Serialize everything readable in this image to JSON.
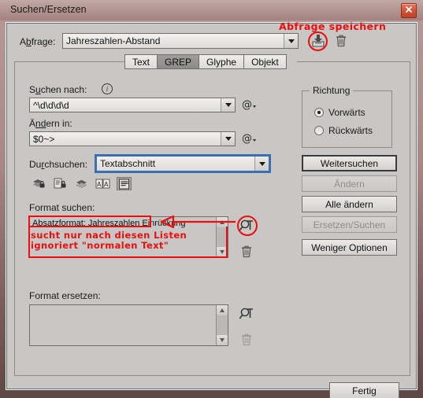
{
  "window": {
    "title": "Suchen/Ersetzen",
    "close_icon": "close-icon",
    "close_glyph": "✕"
  },
  "query_row": {
    "label": "Abfrage:",
    "label_prefix": "A",
    "label_accel": "b",
    "label_suffix": "frage:",
    "value": "Jahreszahlen-Abstand",
    "save_icon": "save-query-icon",
    "delete_icon": "delete-query-icon"
  },
  "tabs": [
    {
      "label": "Text",
      "active": false
    },
    {
      "label": "GREP",
      "active": true
    },
    {
      "label": "Glyphe",
      "active": false
    },
    {
      "label": "Objekt",
      "active": false
    }
  ],
  "find": {
    "label": "Suchen nach:",
    "value": "^\\d\\d\\d\\d",
    "info_icon": "info-icon",
    "meta_icon": "special-character-menu-icon"
  },
  "change": {
    "label": "Ändern in:",
    "value": "$0~>",
    "meta_icon": "special-character-menu-icon"
  },
  "scope": {
    "label": "Durchsuchen:",
    "value": "Textabschnitt",
    "icons": [
      {
        "name": "include-locked-layers-icon",
        "selected": false
      },
      {
        "name": "include-locked-stories-icon",
        "selected": false
      },
      {
        "name": "include-hidden-layers-icon",
        "selected": false
      },
      {
        "name": "include-master-pages-icon",
        "selected": false
      },
      {
        "name": "include-footnotes-icon",
        "selected": true
      }
    ]
  },
  "direction": {
    "title": "Richtung",
    "options": [
      {
        "label": "Vorwärts",
        "selected": true
      },
      {
        "label": "Rückwärts",
        "selected": false
      }
    ]
  },
  "buttons": [
    {
      "label": "Weitersuchen",
      "state": "default"
    },
    {
      "label": "Ändern",
      "state": "disabled"
    },
    {
      "label": "Alle ändern",
      "state": "normal"
    },
    {
      "label": "Ersetzen/Suchen",
      "state": "disabled"
    },
    {
      "label": "Weniger Optionen",
      "state": "normal"
    }
  ],
  "format_find": {
    "label": "Format suchen:",
    "items": [
      "Absatzformat: Jahreszahlen Einrückung"
    ],
    "specify_icon": "specify-attributes-icon",
    "clear_icon": "clear-attributes-icon"
  },
  "format_replace": {
    "label": "Format ersetzen:",
    "items": [],
    "specify_icon": "specify-attributes-icon",
    "clear_icon": "clear-attributes-icon"
  },
  "done_button": {
    "label": "Fertig"
  },
  "annotations": {
    "save_query": "Abfrage speichern",
    "note_line1": "sucht nur nach diesen Listen",
    "note_line2": "ignoriert \"normalen Text\""
  },
  "colors": {
    "annotation_red": "#ee0c0c",
    "dialog_face": "#c9c7c5",
    "titlebar": "#b1938f",
    "focus_blue": "#3a6fb0",
    "tab_active": "#8e8c8a"
  }
}
